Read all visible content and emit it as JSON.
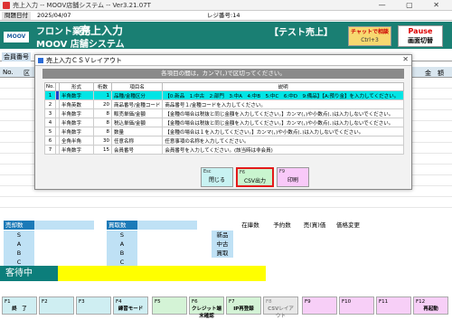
{
  "window": {
    "title": "売上入力 -- MOOV店舗システム -- Ver3.21.07T",
    "controls": "— ▢ ✕"
  },
  "infobar": {
    "date_label": "問題日付",
    "date_value": "2025/04/07",
    "register_label": "レジ番号:14"
  },
  "header": {
    "logo": "MOOV",
    "dept": "フロント業務",
    "title": "売上入力",
    "system": "MOOV 店舗システム",
    "mode": "【テスト売上】",
    "chat_button": {
      "line1": "チャットで相談",
      "line2": "Ctrl+3"
    },
    "pause_button": {
      "line1": "Pause",
      "line2": "画面切替"
    }
  },
  "member": {
    "label": "会員番号"
  },
  "main_table": {
    "col_no": "No.",
    "col_kubun": "区",
    "col_amount": "金　額"
  },
  "modal": {
    "title": "売上入力ＣＳＶレイアウト",
    "close": "✕",
    "notice": "各項目の間は，カンマ(，)で区切ってください。",
    "headers": [
      "No.",
      "形式",
      "桁数",
      "項目名",
      "説明"
    ],
    "rows": [
      {
        "no": "1",
        "fmt": "半角数字",
        "dig": "1",
        "name": "品種/金種区分",
        "desc": "【0:新品　1:中古　2:部門　3:中A　4:中B　5:中C　6:中D　9:備品】【A:預り金】を入力してください。"
      },
      {
        "no": "2",
        "fmt": "半角英数",
        "dig": "20",
        "name": "商品番号/金種コード",
        "desc": "商品番号１/金種コードを入力してください。"
      },
      {
        "no": "3",
        "fmt": "半角数字",
        "dig": "8",
        "name": "販売単価/金額",
        "desc": "【金種の場合は税抜と同じ金額を入力してください。】カンマ(，)や小数点(．)は入力しないでください。"
      },
      {
        "no": "4",
        "fmt": "半角数字",
        "dig": "8",
        "name": "税込単価/金額",
        "desc": "【金種の場合は税抜と同じ金額を入力してください。】カンマ(，)や小数点(．)は入力しないでください。"
      },
      {
        "no": "5",
        "fmt": "半角数字",
        "dig": "8",
        "name": "数量",
        "desc": "【金種の場合は１を入力してください。】カンマ(，)や小数点(．)は入力しないでください。"
      },
      {
        "no": "6",
        "fmt": "全角半角",
        "dig": "30",
        "name": "任意名称",
        "desc": "任意事項の名称を入力してください。"
      },
      {
        "no": "7",
        "fmt": "半角数字",
        "dig": "15",
        "name": "会員番号",
        "desc": "会員番号を入力してください。(該当時は非会員)"
      }
    ],
    "buttons": {
      "close": {
        "key": "Esc",
        "label": "閉じる"
      },
      "csv": {
        "key": "F6",
        "label": "CSV出力"
      },
      "print": {
        "key": "F9",
        "label": "印刷"
      }
    }
  },
  "lower": {
    "sales_head": "売却数",
    "buy_head": "買取数",
    "ranks": [
      "S",
      "A",
      "B",
      "C"
    ],
    "stats_headers": [
      "在庫数",
      "予約数",
      "売(買)価",
      "価格変更"
    ],
    "stats_rows": [
      "新品",
      "中古",
      "買取"
    ],
    "status_label": "客待中"
  },
  "fkeys": [
    {
      "n": "F1",
      "t": "終　了"
    },
    {
      "n": "F2",
      "t": ""
    },
    {
      "n": "F3",
      "t": ""
    },
    {
      "n": "F4",
      "t": "練習モード"
    },
    {
      "n": "F5",
      "t": ""
    },
    {
      "n": "F6",
      "t": "クレジット端末確認"
    },
    {
      "n": "F7",
      "t": "IP再登録"
    },
    {
      "n": "F8",
      "t": "CSVレイアウト"
    },
    {
      "n": "F9",
      "t": ""
    },
    {
      "n": "F10",
      "t": ""
    },
    {
      "n": "F11",
      "t": ""
    },
    {
      "n": "F12",
      "t": "再起動"
    }
  ],
  "colors": {
    "header_green": "#1a7f73",
    "selected_row": "#00e5e5",
    "status_yellow": "#ffff00",
    "csv_highlight": "#e31a1a"
  }
}
